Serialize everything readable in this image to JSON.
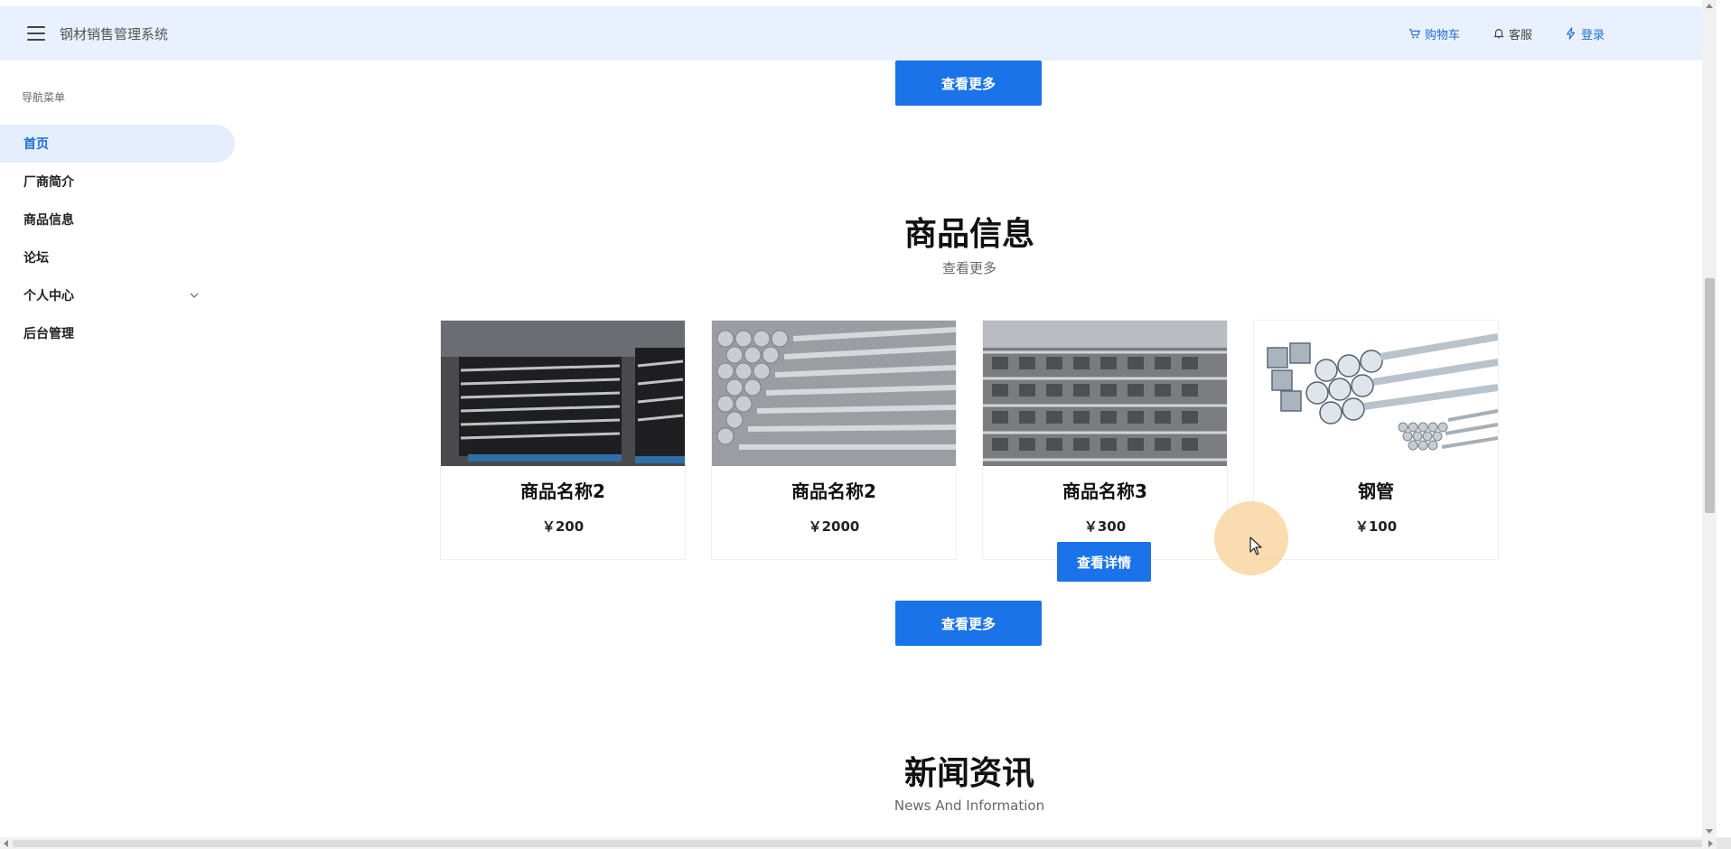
{
  "header": {
    "title": "钢材销售管理系统",
    "actions": [
      {
        "label": "购物车",
        "icon": "cart-icon"
      },
      {
        "label": "客服",
        "icon": "bell-icon"
      },
      {
        "label": "登录",
        "icon": "bolt-icon"
      }
    ]
  },
  "sidebar": {
    "heading": "导航菜单",
    "items": [
      {
        "label": "首页",
        "active": true
      },
      {
        "label": "厂商简介"
      },
      {
        "label": "商品信息"
      },
      {
        "label": "论坛"
      },
      {
        "label": "个人中心",
        "expandable": true
      },
      {
        "label": "后台管理"
      }
    ]
  },
  "main": {
    "view_more_label": "查看更多",
    "products_section": {
      "title": "商品信息",
      "subtitle": "查看更多",
      "items": [
        {
          "name": "商品名称2",
          "price": "￥200",
          "image": "stacked-steel-racks-photo"
        },
        {
          "name": "商品名称2",
          "price": "￥2000",
          "image": "galvanized-pipes-photo"
        },
        {
          "name": "商品名称3",
          "price": "￥300",
          "image": "steel-channels-photo"
        },
        {
          "name": "钢管",
          "price": "￥100",
          "image": "steel-pipes-tubes-photo"
        }
      ],
      "detail_button_label": "查看详情"
    },
    "news_section": {
      "title": "新闻资讯",
      "subtitle": "News And Information"
    }
  },
  "colors": {
    "accent": "#1a73e8",
    "header_bg": "#e8f1fd",
    "active_nav_bg": "#e4eefc",
    "cursor_halo": "#f7d296"
  }
}
